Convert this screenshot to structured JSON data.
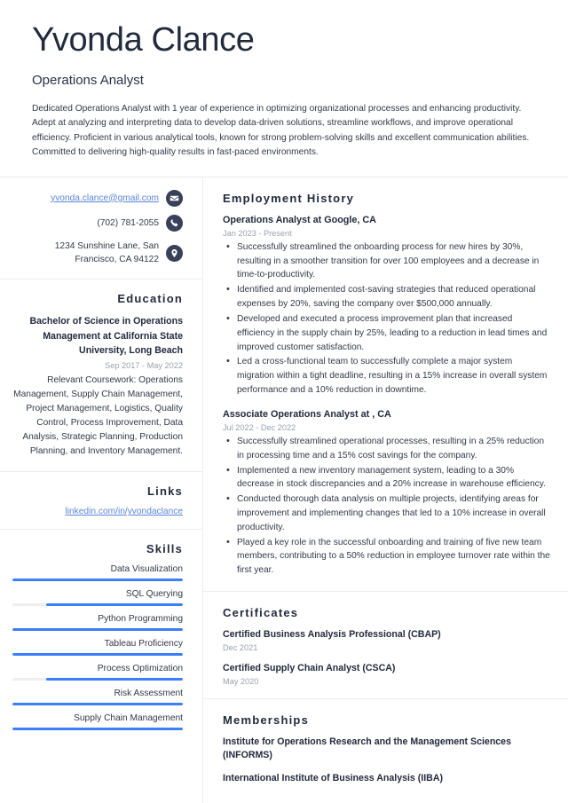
{
  "header": {
    "name": "Yvonda Clance",
    "job_title": "Operations Analyst",
    "summary": "Dedicated Operations Analyst with 1 year of experience in optimizing organizational processes and enhancing productivity. Adept at analyzing and interpreting data to develop data-driven solutions, streamline workflows, and improve operational efficiency. Proficient in various analytical tools, known for strong problem-solving skills and excellent communication abilities. Committed to delivering high-quality results in fast-paced environments."
  },
  "contact": {
    "email": "yvonda.clance@gmail.com",
    "phone": "(702) 781-2055",
    "address": "1234 Sunshine Lane, San Francisco, CA 94122",
    "icons": [
      "envelope-icon",
      "phone-icon",
      "location-pin-icon"
    ]
  },
  "education": {
    "heading": "Education",
    "degree": "Bachelor of Science in Operations Management at California State University, Long Beach",
    "date": "Sep 2017 - May 2022",
    "description": "Relevant Coursework: Operations Management, Supply Chain Management, Project Management, Logistics, Quality Control, Process Improvement, Data Analysis, Strategic Planning, Production Planning, and Inventory Management."
  },
  "links": {
    "heading": "Links",
    "items": [
      {
        "label": "linkedin.com/in/yvondaclance"
      }
    ]
  },
  "skills": {
    "heading": "Skills",
    "items": [
      {
        "name": "Data Visualization",
        "level": 100
      },
      {
        "name": "SQL Querying",
        "level": 80
      },
      {
        "name": "Python Programming",
        "level": 100
      },
      {
        "name": "Tableau Proficiency",
        "level": 100
      },
      {
        "name": "Process Optimization",
        "level": 80
      },
      {
        "name": "Risk Assessment",
        "level": 100
      },
      {
        "name": "Supply Chain Management",
        "level": 100
      }
    ]
  },
  "employment": {
    "heading": "Employment History",
    "entries": [
      {
        "title": "Operations Analyst at Google, CA",
        "date": "Jan 2023 - Present",
        "bullets": [
          "Successfully streamlined the onboarding process for new hires by 30%, resulting in a smoother transition for over 100 employees and a decrease in time-to-productivity.",
          "Identified and implemented cost-saving strategies that reduced operational expenses by 20%, saving the company over $500,000 annually.",
          "Developed and executed a process improvement plan that increased efficiency in the supply chain by 25%, leading to a reduction in lead times and improved customer satisfaction.",
          "Led a cross-functional team to successfully complete a major system migration within a tight deadline, resulting in a 15% increase in overall system performance and a 10% reduction in downtime."
        ]
      },
      {
        "title": "Associate Operations Analyst at , CA",
        "date": "Jul 2022 - Dec 2022",
        "bullets": [
          "Successfully streamlined operational processes, resulting in a 25% reduction in processing time and a 15% cost savings for the company.",
          "Implemented a new inventory management system, leading to a 30% decrease in stock discrepancies and a 20% increase in warehouse efficiency.",
          "Conducted thorough data analysis on multiple projects, identifying areas for improvement and implementing changes that led to a 10% increase in overall productivity.",
          "Played a key role in the successful onboarding and training of five new team members, contributing to a 50% reduction in employee turnover rate within the first year."
        ]
      }
    ]
  },
  "certificates": {
    "heading": "Certificates",
    "items": [
      {
        "name": "Certified Business Analysis Professional (CBAP)",
        "date": "Dec 2021"
      },
      {
        "name": "Certified Supply Chain Analyst (CSCA)",
        "date": "May 2020"
      }
    ]
  },
  "memberships": {
    "heading": "Memberships",
    "items": [
      {
        "name": "Institute for Operations Research and the Management Sciences (INFORMS)"
      },
      {
        "name": "International Institute of Business Analysis (IIBA)"
      }
    ]
  },
  "colors": {
    "accent_blue": "#3b7ef7",
    "link_blue": "#5b86d8",
    "icon_navy": "#39405a",
    "heading_dark": "#222a3d",
    "muted_gray": "#9aa0ad",
    "bar_track": "#eceef1"
  }
}
